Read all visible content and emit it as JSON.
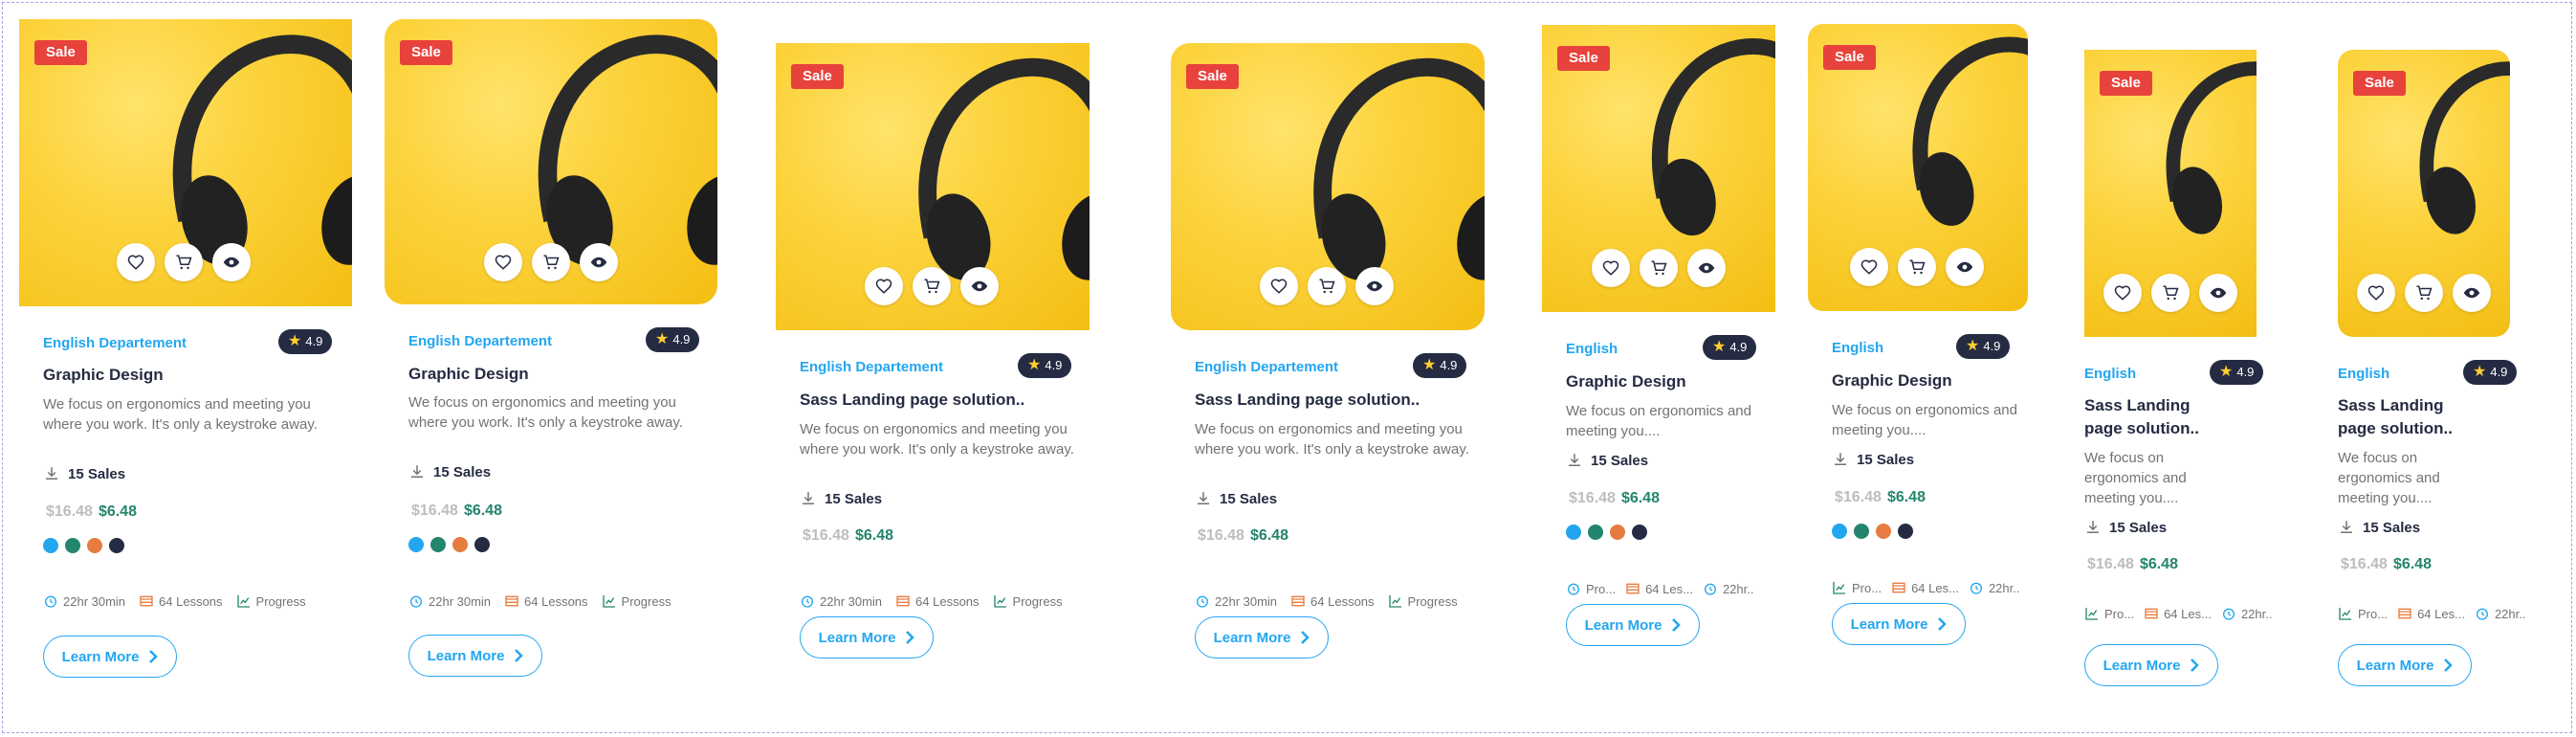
{
  "common": {
    "sale": "Sale",
    "category_full": "English Departement",
    "category_short": "English",
    "rating": "4.9",
    "title_graphic": "Graphic Design",
    "title_sass": "Sass Landing page solution..",
    "desc_full": "We focus on ergonomics and meeting you where you work. It's only a keystroke away.",
    "desc_short": "We focus on ergonomics and meeting you....",
    "sales": "15 Sales",
    "price_old": "$16.48",
    "price_new": "$6.48",
    "time": "22hr 30min",
    "time_short": "22hr..",
    "lessons": "64 Lessons",
    "lessons_short": "64 Les...",
    "progress": "Progress",
    "progress_short": "Pro...",
    "learn_more": "Learn More"
  },
  "swatches": [
    "#23a6f0",
    "#23856d",
    "#e77c40",
    "#252b42"
  ],
  "colors": {
    "accent": "#23a6f0",
    "sale": "#e8423c",
    "dark": "#252b42",
    "price_new": "#23856d",
    "yellow": "#fcd33d"
  }
}
